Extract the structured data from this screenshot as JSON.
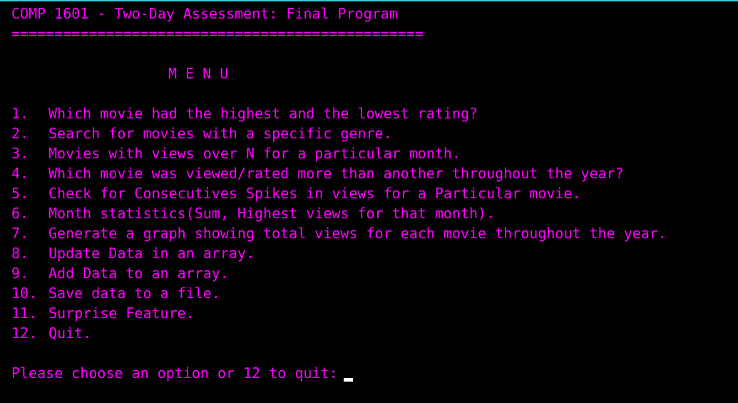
{
  "colors": {
    "background": "#000000",
    "text": "#ff00ff",
    "top_border": "#3bc8d6",
    "cursor": "#ffffff"
  },
  "header": {
    "title": "COMP 1601 - Two-Day Assessment: Final Program",
    "rule": "================================================"
  },
  "menu": {
    "heading": "M E N U",
    "items": [
      {
        "number": "1.",
        "label": "Which movie had the highest and the lowest rating?"
      },
      {
        "number": "2.",
        "label": "Search for movies with a specific genre."
      },
      {
        "number": "3.",
        "label": "Movies with views over N for a particular month."
      },
      {
        "number": "4.",
        "label": "Which movie was viewed/rated more than another throughout the year?"
      },
      {
        "number": "5.",
        "label": "Check for Consecutives Spikes in views for a Particular movie."
      },
      {
        "number": "6.",
        "label": "Month statistics(Sum, Highest views for that month)."
      },
      {
        "number": "7.",
        "label": "Generate a graph showing total views for each movie throughout the year."
      },
      {
        "number": "8.",
        "label": "Update Data in an array."
      },
      {
        "number": "9.",
        "label": "Add Data to an array."
      },
      {
        "number": "10.",
        "label": "Save data to a file."
      },
      {
        "number": "11.",
        "label": "Surprise Feature."
      },
      {
        "number": "12.",
        "label": "Quit."
      }
    ]
  },
  "prompt": {
    "text": "Please choose an option or 12 to quit:"
  },
  "cursor_icon": "block-cursor-icon"
}
